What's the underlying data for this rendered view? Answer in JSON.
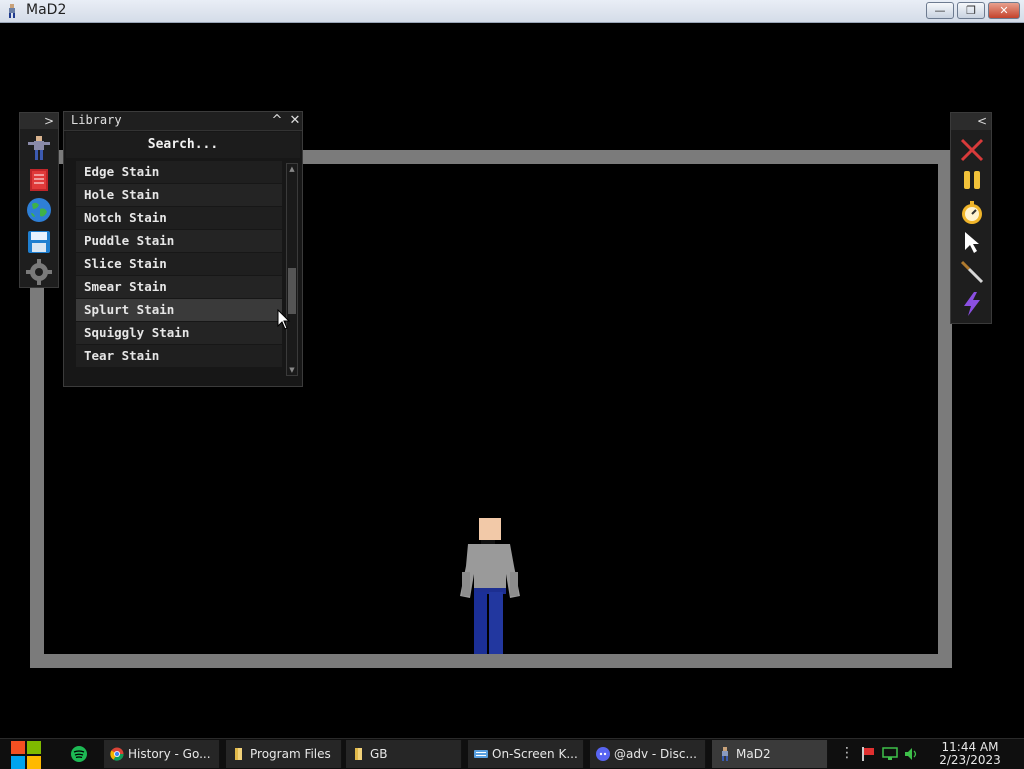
{
  "window": {
    "title": "MaD2",
    "minimize": "—",
    "maximize": "❐",
    "close": "✕"
  },
  "left_toolbar": {
    "expand_glyph": ">"
  },
  "library": {
    "title": "Library",
    "collapse_glyph": "^",
    "close_glyph": "✕",
    "search_placeholder": "Search...",
    "items": [
      "Edge Stain",
      "Hole Stain",
      "Notch Stain",
      "Puddle Stain",
      "Slice Stain",
      "Smear Stain",
      "Splurt Stain",
      "Squiggly Stain",
      "Tear Stain"
    ],
    "hovered_index": 6
  },
  "right_toolbar": {
    "collapse_glyph": "<"
  },
  "taskbar": {
    "items": [
      {
        "label": "History - Go...",
        "icon": "chrome-icon"
      },
      {
        "label": "Program Files",
        "icon": "folder-icon"
      },
      {
        "label": "GB",
        "icon": "folder-icon"
      },
      {
        "label": "On-Screen K...",
        "icon": "keyboard-icon"
      },
      {
        "label": "@adv - Disc...",
        "icon": "discord-icon"
      },
      {
        "label": "MaD2",
        "icon": "mad2-icon"
      }
    ],
    "clock_time": "11:44 AM",
    "clock_date": "2/23/2023"
  },
  "colors": {
    "arena_border": "#7b7b7b",
    "background": "#000000"
  }
}
